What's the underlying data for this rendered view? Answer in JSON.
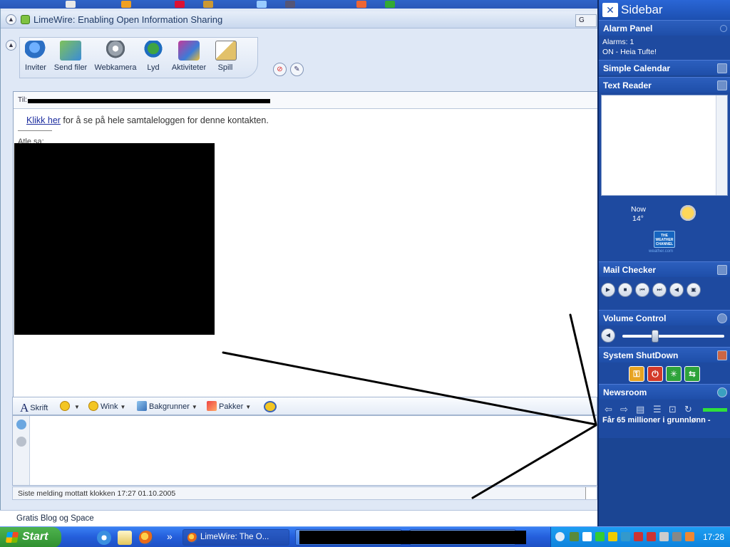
{
  "window": {
    "title": "LimeWire: Enabling Open Information Sharing",
    "right_stub": "G"
  },
  "toolbar": {
    "items": [
      {
        "label": "Inviter",
        "icon": "invite-contact-icon"
      },
      {
        "label": "Send filer",
        "icon": "send-files-icon"
      },
      {
        "label": "Webkamera",
        "icon": "webcam-icon"
      },
      {
        "label": "Lyd",
        "icon": "audio-icon"
      },
      {
        "label": "Aktiviteter",
        "icon": "activities-icon"
      },
      {
        "label": "Spill",
        "icon": "games-icon"
      }
    ]
  },
  "conversation": {
    "to_label": "Til:",
    "history_link": "Klikk her",
    "history_text": " for å se på hele samtaleloggen for denne kontakten.",
    "sender": "Atle sa:"
  },
  "format_bar": {
    "font": "Skrift",
    "wink": "Wink",
    "backgrounds": "Bakgrunner",
    "packs": "Pakker"
  },
  "status": {
    "last_message": "Siste melding mottatt klokken 17:27 01.10.2005"
  },
  "ad": {
    "text": "Gratis Blog og Space"
  },
  "sidebar": {
    "title": "Sidebar",
    "alarm": {
      "title": "Alarm Panel",
      "line1": "Alarms: 1",
      "line2": "ON - Heia Tufte!"
    },
    "calendar": {
      "title": "Simple Calendar"
    },
    "text_reader": {
      "title": "Text Reader"
    },
    "weather": {
      "now_label": "Now",
      "temp": "14°",
      "logo_text": "THE WEATHER CHANNEL",
      "site": "weather.com"
    },
    "mail": {
      "title": "Mail Checker"
    },
    "volume": {
      "title": "Volume Control",
      "level": 0.32
    },
    "shutdown": {
      "title": "System ShutDown"
    },
    "news": {
      "title": "Newsroom",
      "headline": "Får 65 millioner i grunnlønn -"
    }
  },
  "taskbar": {
    "start": "Start",
    "more": "»",
    "task_limewire": "LimeWire: The O...",
    "clock": "17:28"
  },
  "colors": {
    "sidebar_bg": "#1b4593",
    "taskbar": "#245edb",
    "tray": "#0d82dc"
  }
}
